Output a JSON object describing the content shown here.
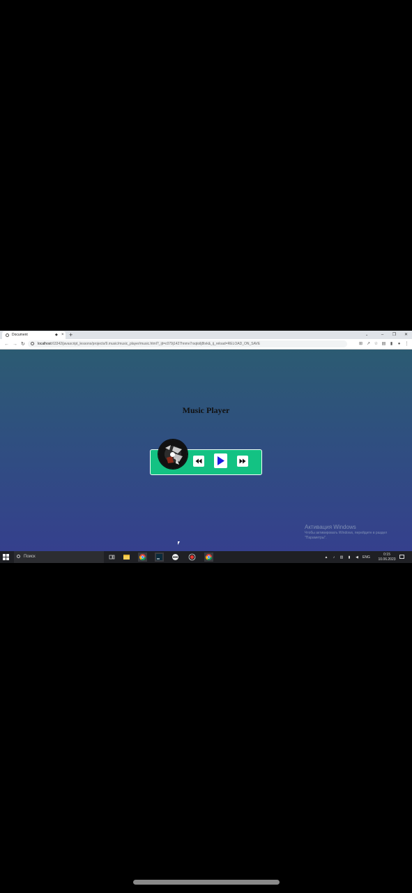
{
  "browser": {
    "tab_title": "Document",
    "tab_close": "×",
    "new_tab": "+",
    "tab_list": "⌄",
    "window_controls": {
      "minimize": "–",
      "maximize": "❐",
      "close": "✕"
    },
    "nav": {
      "back": "←",
      "forward": "→",
      "reload": "↻"
    },
    "url_host": "localhost",
    "url_path": ":63342/javascript_lessons/projects/9.music/music_player/music.html?_ijt=c079j1427hnmv7rsqtoilj8tvk&_ij_reload=RELOAD_ON_SAVE"
  },
  "page": {
    "title": "Music Player",
    "controls": [
      "previous-button",
      "play-button",
      "next-button"
    ]
  },
  "activation": {
    "title": "Активация Windows",
    "subtitle": "Чтобы активировать Windows, перейдите в раздел \"Параметры\"."
  },
  "taskbar": {
    "search_placeholder": "Поиск",
    "language": "ENG",
    "time": "0:15",
    "date": "10.06.2023"
  },
  "colors": {
    "player_bg": "#13c283",
    "control_icon": "#1e1ee0",
    "page_gradient_top": "#2c5b72",
    "page_gradient_bottom": "#35408d"
  }
}
